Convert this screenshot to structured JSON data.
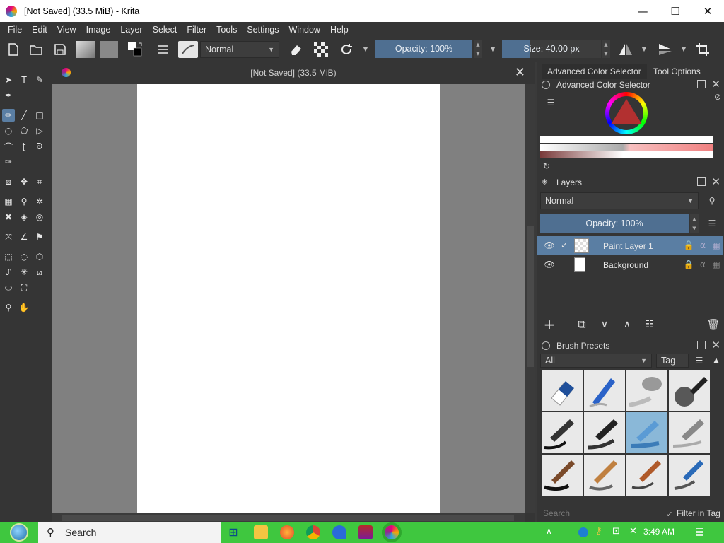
{
  "window": {
    "title": "[Not Saved]  (33.5 MiB)  - Krita",
    "minimize": "—",
    "maximize": "☐",
    "close": "✕"
  },
  "menu": [
    "File",
    "Edit",
    "View",
    "Image",
    "Layer",
    "Select",
    "Filter",
    "Tools",
    "Settings",
    "Window",
    "Help"
  ],
  "toolbar": {
    "blend_mode": "Normal",
    "opacity_label": "Opacity: 100%",
    "size_label": "Size: 40.00 px"
  },
  "document": {
    "title": "[Not Saved]  (33.5 MiB)",
    "close": "✕"
  },
  "dockers": {
    "tabs": [
      "Advanced Color Selector",
      "Tool Options"
    ],
    "color_selector_title": "Advanced Color Selector",
    "layers_title": "Layers",
    "layers_blend_mode": "Normal",
    "layers_opacity": "Opacity:  100%",
    "layers": [
      {
        "name": "Paint Layer 1",
        "selected": true,
        "visible": true
      },
      {
        "name": "Background",
        "selected": false,
        "visible": true
      }
    ],
    "brush_presets_title": "Brush Presets",
    "brush_filter": "All",
    "tag_label": "Tag",
    "search_placeholder": "Search",
    "filter_in_tag": "Filter in Tag"
  },
  "taskbar": {
    "search_label": "Search",
    "time": "3:49 AM"
  },
  "colors": {
    "accent": "#5a7ea3",
    "panel": "#353535",
    "canvas_bg": "#808080",
    "taskbar": "#3fc73f"
  }
}
